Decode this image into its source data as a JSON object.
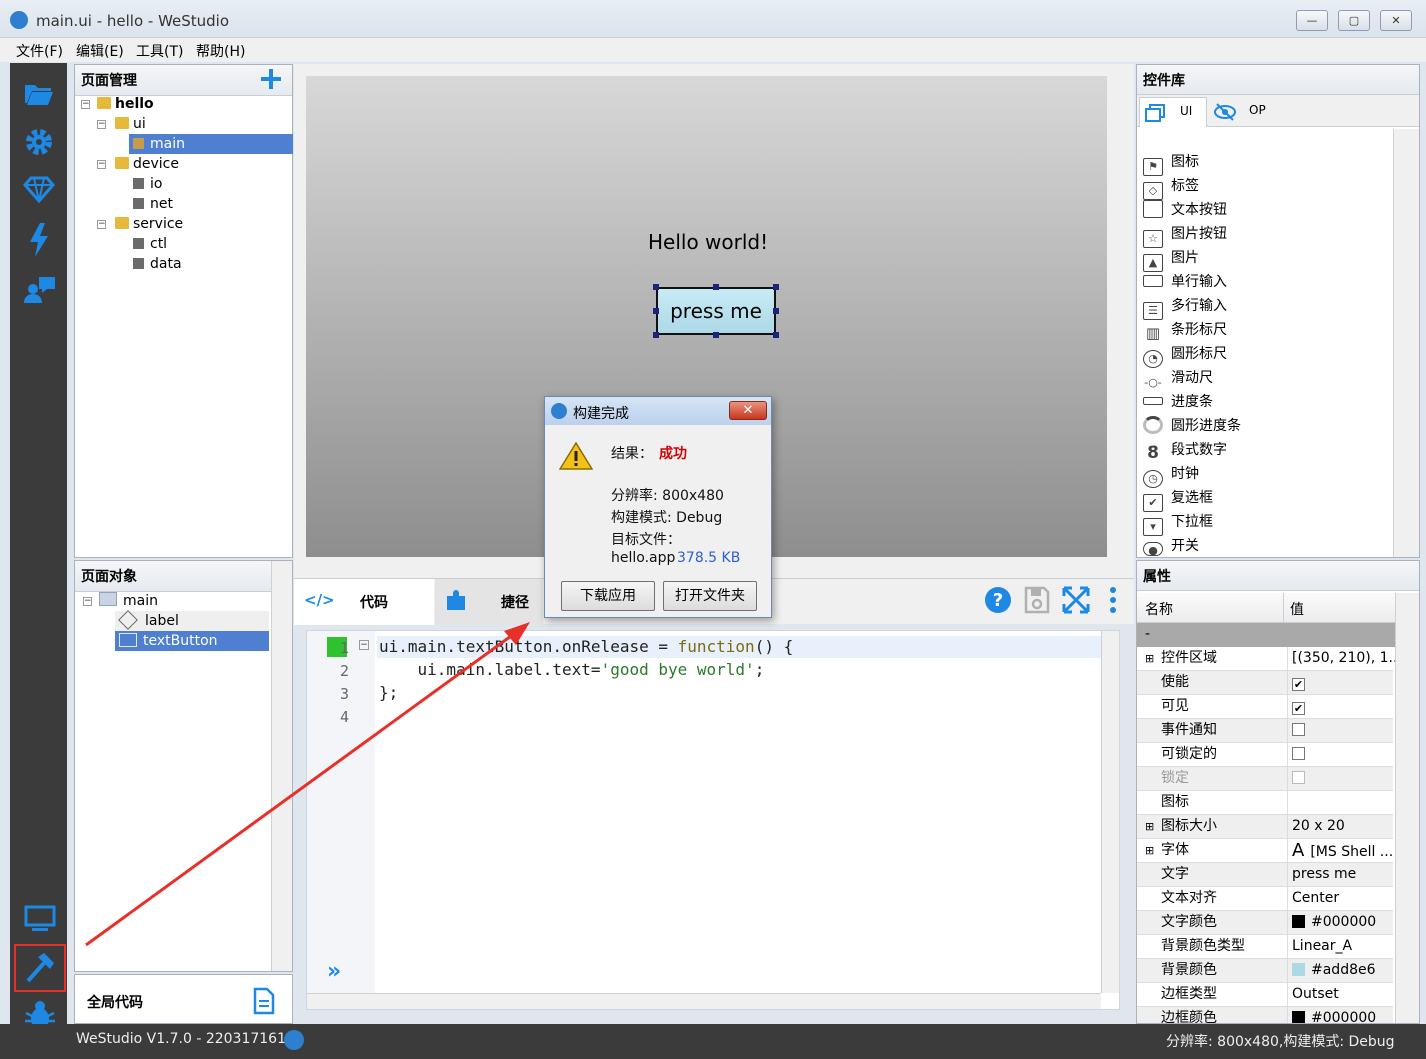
{
  "window": {
    "title": "main.ui - hello - WeStudio",
    "minimize": "—",
    "maximize": "▢",
    "close": "✕"
  },
  "menu": [
    "文件(F)",
    "编辑(E)",
    "工具(T)",
    "帮助(H)"
  ],
  "page_manager": {
    "title": "页面管理",
    "tree": [
      {
        "label": "hello"
      },
      {
        "label": "ui"
      },
      {
        "label": "main"
      },
      {
        "label": "device"
      },
      {
        "label": "io"
      },
      {
        "label": "net"
      },
      {
        "label": "service"
      },
      {
        "label": "ctl"
      },
      {
        "label": "data"
      }
    ]
  },
  "page_objects": {
    "title": "页面对象",
    "items": [
      {
        "label": "main"
      },
      {
        "label": "label"
      },
      {
        "label": "textButton"
      }
    ]
  },
  "global_code": {
    "title": "全局代码"
  },
  "canvas": {
    "hello_text": "Hello world!",
    "button_text": "press me"
  },
  "code_tabs": {
    "code": "代码",
    "shortcut": "捷径"
  },
  "code": {
    "line_numbers": [
      "1",
      "2",
      "3",
      "4"
    ],
    "l1_a": "ui.main.textButton.onRelease = ",
    "l1_kw": "function",
    "l1_b": "() {",
    "l2_a": "    ui.main.label.text=",
    "l2_str": "'good bye world'",
    "l2_b": ";",
    "l3": "};"
  },
  "dialog": {
    "title": "构建完成",
    "result_label": "结果：",
    "result_value": "成功",
    "resolution": "分辨率: 800x480",
    "mode": "构建模式: Debug",
    "target_label": "目标文件：",
    "target_file": "hello.app",
    "target_size": "378.5 KB",
    "download_button": "下载应用",
    "open_folder_button": "打开文件夹"
  },
  "library": {
    "title": "控件库",
    "tab_ui": "UI",
    "tab_op": "OP",
    "items": [
      "图标",
      "标签",
      "文本按钮",
      "图片按钮",
      "图片",
      "单行输入",
      "多行输入",
      "条形标尺",
      "圆形标尺",
      "滑动尺",
      "进度条",
      "圆形进度条",
      "段式数字",
      "时钟",
      "复选框",
      "下拉框",
      "开关"
    ]
  },
  "properties": {
    "title": "属性",
    "col_name": "名称",
    "col_value": "值",
    "group": "-",
    "rows": [
      {
        "name": "控件区域",
        "value": "[(350, 210), 1..."
      },
      {
        "name": "使能",
        "value": "✔"
      },
      {
        "name": "可见",
        "value": "✔"
      },
      {
        "name": "事件通知",
        "value": ""
      },
      {
        "name": "可锁定的",
        "value": ""
      },
      {
        "name": "锁定",
        "value": ""
      },
      {
        "name": "图标",
        "value": ""
      },
      {
        "name": "图标大小",
        "value": "20 x 20"
      },
      {
        "name": "字体",
        "value": "[MS Shell ..."
      },
      {
        "name": "文字",
        "value": "press me"
      },
      {
        "name": "文本对齐",
        "value": "Center"
      },
      {
        "name": "文字颜色",
        "value": "#000000"
      },
      {
        "name": "背景颜色类型",
        "value": "Linear_A"
      },
      {
        "name": "背景颜色",
        "value": "#add8e6"
      },
      {
        "name": "边框类型",
        "value": "Outset"
      },
      {
        "name": "边框颜色",
        "value": "#000000"
      }
    ],
    "font_glyph": "A"
  },
  "status": {
    "left": "WeStudio V1.7.0 - 2203171613",
    "right": "分辨率: 800x480,构建模式: Debug"
  },
  "colors": {
    "accent": "#1e88e5",
    "selection": "#4e7fd0",
    "annotation": "#e8302a",
    "success": "#d40000"
  }
}
